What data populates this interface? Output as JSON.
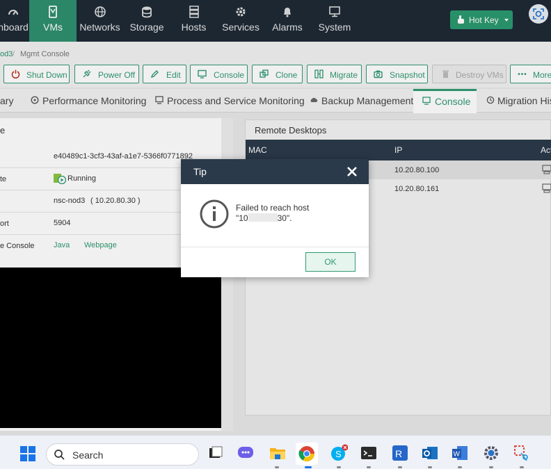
{
  "nav": {
    "items": [
      {
        "label": "hboard",
        "icon": "dashboard-icon"
      },
      {
        "label": "VMs",
        "icon": "vm-icon",
        "active": true
      },
      {
        "label": "Networks",
        "icon": "globe-icon"
      },
      {
        "label": "Storage",
        "icon": "database-icon"
      },
      {
        "label": "Hosts",
        "icon": "server-icon"
      },
      {
        "label": "Services",
        "icon": "gear-icon"
      },
      {
        "label": "Alarms",
        "icon": "bell-icon"
      },
      {
        "label": "System",
        "icon": "monitor-icon"
      }
    ],
    "hotkey_label": "Hot Key"
  },
  "breadcrumb": {
    "parent": "od3",
    "separator": "/",
    "current": "Mgmt Console"
  },
  "toolbar": {
    "buttons": [
      {
        "label": "Shut Down",
        "icon": "power-icon"
      },
      {
        "label": "Power Off",
        "icon": "plug-icon"
      },
      {
        "label": "Edit",
        "icon": "pencil-icon"
      },
      {
        "label": "Console",
        "icon": "console-icon"
      },
      {
        "label": "Clone",
        "icon": "clone-icon"
      },
      {
        "label": "Migrate",
        "icon": "migrate-icon"
      },
      {
        "label": "Snapshot",
        "icon": "camera-icon"
      },
      {
        "label": "Destroy VMs",
        "icon": "trash-icon"
      },
      {
        "label": "More",
        "icon": "ellipsis-icon"
      }
    ]
  },
  "tabs": [
    {
      "label": "ary"
    },
    {
      "label": "Performance Monitoring"
    },
    {
      "label": "Process and Service Monitoring"
    },
    {
      "label": "Backup Management"
    },
    {
      "label": "Console",
      "active": true
    },
    {
      "label": "Migration Hist"
    }
  ],
  "left_panel": {
    "title": "e",
    "rows": [
      {
        "key": "",
        "value": "e40489c1-3cf3-43af-a1e7-5366f0771892"
      },
      {
        "key": "te",
        "value": "Running"
      },
      {
        "key": "",
        "value": "nsc-nod3",
        "value_extra": "( 10.20.80.30 )"
      },
      {
        "key": "ort",
        "value": "5904"
      },
      {
        "key": "e Console",
        "link1": "Java",
        "link2": "Webpage"
      }
    ]
  },
  "remote_desktops": {
    "title": "Remote Desktops",
    "columns": [
      "MAC",
      "IP",
      "Act"
    ],
    "rows": [
      {
        "mac": "",
        "ip": "10.20.80.100"
      },
      {
        "mac": "",
        "ip": "10.20.80.161"
      }
    ]
  },
  "dialog": {
    "title": "Tip",
    "message_line1": "Failed to reach host",
    "message_line2_start": "\"10",
    "message_line2_end": "30\".",
    "ok_label": "OK"
  },
  "taskbar": {
    "search_label": "Search"
  }
}
